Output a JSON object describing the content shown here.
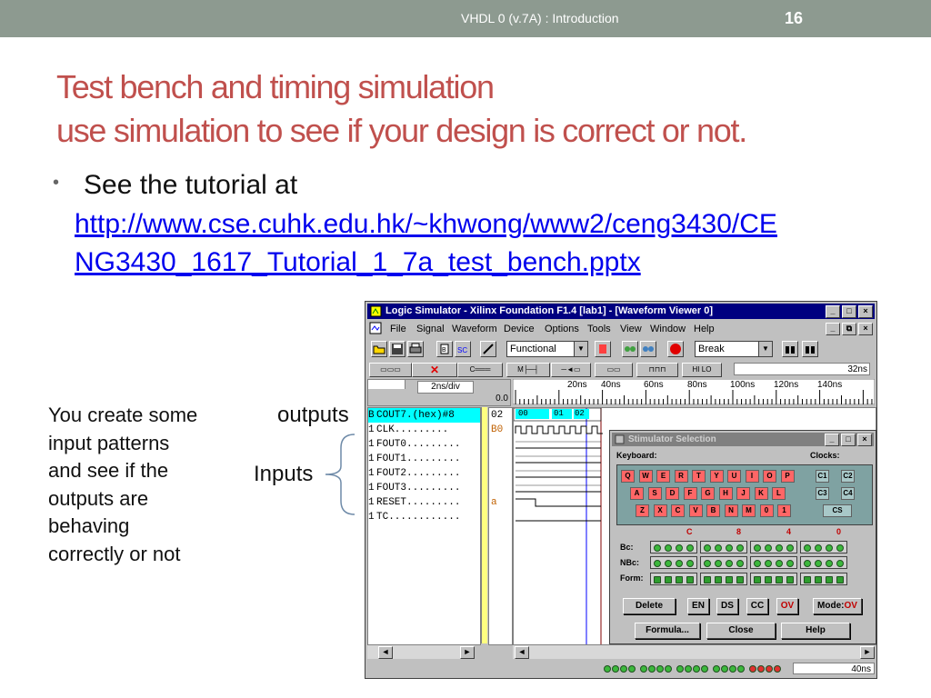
{
  "header": {
    "title": "VHDL 0 (v.7A) : Introduction",
    "slide_number": "16"
  },
  "heading": {
    "line1": "Test bench and timing simulation",
    "line2": "use simulation to see if your design is correct or not."
  },
  "bullet": {
    "text": "See the tutorial at",
    "link_line1": "http://www.cse.cuhk.edu.hk/~khwong/www2/ceng3430/CE",
    "link_line2": "NG3430_1617_Tutorial_1_7a_test_bench.pptx"
  },
  "side_note": [
    "You create some",
    "input patterns",
    "and see if the",
    "outputs are",
    "behaving",
    "correctly or not"
  ],
  "labels": {
    "outputs": "outputs",
    "inputs": "Inputs"
  },
  "window": {
    "title": "Logic Simulator - Xilinx Foundation F1.4 [lab1] - [Waveform Viewer 0]",
    "menu": [
      "File",
      "Signal",
      "Waveform",
      "Device",
      "Options",
      "Tools",
      "View",
      "Window",
      "Help"
    ],
    "mode_select": "Functional",
    "break_select": "Break",
    "time_readout": "32ns",
    "scale_label": "2ns/div",
    "origin_label": "0.0",
    "ruler_ticks": [
      "20ns",
      "40ns",
      "60ns",
      "80ns",
      "100ns",
      "120ns",
      "140ns"
    ],
    "signals": [
      {
        "prefix": "B",
        "name": "COUT7.(hex)#8",
        "value": "02"
      },
      {
        "prefix": "1",
        "name": "CLK.........",
        "value": "B0"
      },
      {
        "prefix": "1",
        "name": "FOUT0.........",
        "value": ""
      },
      {
        "prefix": "1",
        "name": "FOUT1.........",
        "value": ""
      },
      {
        "prefix": "1",
        "name": "FOUT2.........",
        "value": ""
      },
      {
        "prefix": "1",
        "name": "FOUT3.........",
        "value": ""
      },
      {
        "prefix": "1",
        "name": "RESET.........",
        "value": "a"
      },
      {
        "prefix": "1",
        "name": "TC............",
        "value": ""
      }
    ],
    "bus_values": [
      "00",
      "01",
      "02"
    ],
    "status_time": "40ns",
    "window_controls": [
      "_",
      "□",
      "×"
    ],
    "doc_controls": [
      "_",
      "⧉",
      "×"
    ]
  },
  "stimulator": {
    "title": "Stimulator Selection",
    "keyboard_label": "Keyboard:",
    "clocks_label": "Clocks:",
    "keys_row1": [
      "Q",
      "W",
      "E",
      "R",
      "T",
      "Y",
      "U",
      "I",
      "O",
      "P"
    ],
    "keys_row2": [
      "A",
      "S",
      "D",
      "F",
      "G",
      "H",
      "J",
      "K",
      "L"
    ],
    "keys_row3": [
      "Z",
      "X",
      "C",
      "V",
      "B",
      "N",
      "M",
      "0",
      "1"
    ],
    "clock_keys": [
      "C1",
      "C2",
      "C3",
      "C4",
      "CS"
    ],
    "hex_headers": [
      "C",
      "8",
      "4",
      "0"
    ],
    "row_labels": [
      "Bc:",
      "NBc:",
      "Form:"
    ],
    "buttons_row1": [
      "Delete",
      "EN",
      "DS",
      "CC",
      "OV"
    ],
    "mode_label": "Mode:",
    "mode_value": "OV",
    "buttons_row2": [
      "Formula...",
      "Close",
      "Help"
    ],
    "title_controls": [
      "_",
      "□",
      "×"
    ]
  },
  "colors": {
    "accent": "#c0504d",
    "header_bg": "#8d9a90",
    "link": "#0000ee",
    "titlebar": "#000080"
  }
}
